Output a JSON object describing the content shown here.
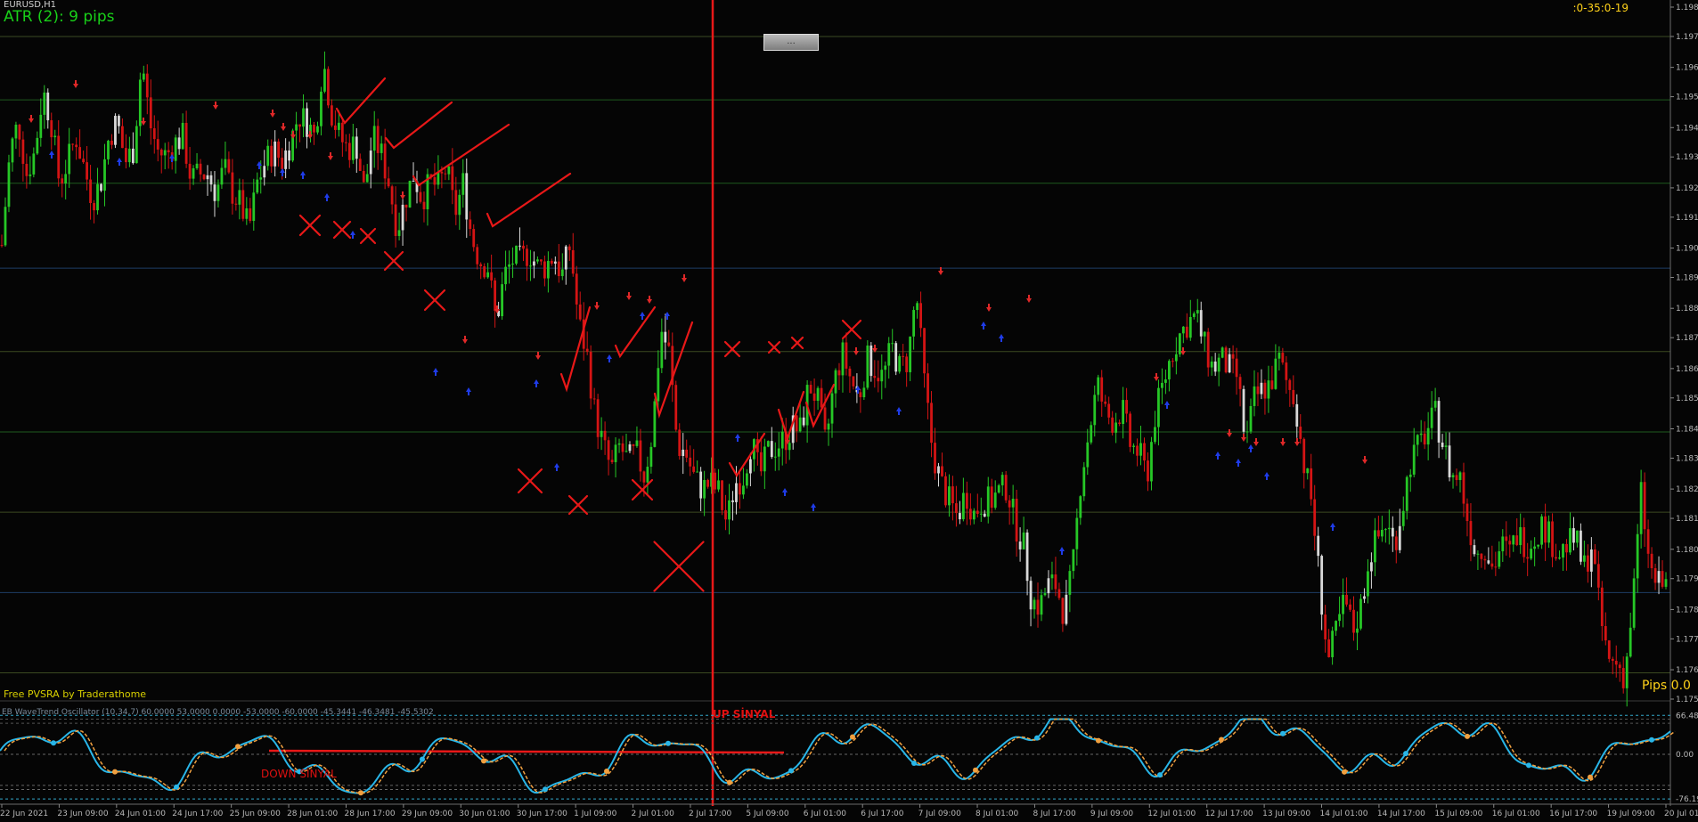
{
  "header": {
    "symbol": "EURUSD,H1",
    "atr_text": "ATR (2): 9 pips",
    "timer": ":0-35:0-19"
  },
  "top_button": {
    "label": "..."
  },
  "indicator": {
    "label": "Free  PVSRA  by  Traderathome",
    "header_text": "EB WaveTrend Oscillator (10,34,7) 60.0000 53.0000 0.0000 -53.0000 -60.0000 -45.3441 -46.3481 -45.5302",
    "scale": [
      "66.4856",
      "0.00",
      "-76.1966"
    ]
  },
  "annotations": {
    "up_signal": "UP SİNYAL",
    "down_signal": "DOWN SİNYAL",
    "pips": "Pips 0.0"
  },
  "chart_data": {
    "type": "candlestick",
    "symbol": "EURUSD",
    "timeframe": "H1",
    "price_axis": [
      "1.19820",
      "1.19725",
      "1.19625",
      "1.19530",
      "1.19430",
      "1.19335",
      "1.19235",
      "1.19140",
      "1.19040",
      "1.18945",
      "1.18845",
      "1.18750",
      "1.18650",
      "1.18555",
      "1.18455",
      "1.18360",
      "1.18260",
      "1.18165",
      "1.18065",
      "1.17970",
      "1.17870",
      "1.17775",
      "1.17675",
      "1.17580"
    ],
    "ylim": [
      1.1758,
      1.1982
    ],
    "time_axis": [
      "22 Jun 2021",
      "23 Jun 09:00",
      "24 Jun 01:00",
      "24 Jun 17:00",
      "25 Jun 09:00",
      "28 Jun 01:00",
      "28 Jun 17:00",
      "29 Jun 09:00",
      "30 Jun 01:00",
      "30 Jun 17:00",
      "1 Jul 09:00",
      "2 Jul 01:00",
      "2 Jul 17:00",
      "5 Jul 09:00",
      "6 Jul 01:00",
      "6 Jul 17:00",
      "7 Jul 09:00",
      "8 Jul 01:00",
      "8 Jul 17:00",
      "9 Jul 09:00",
      "12 Jul 01:00",
      "12 Jul 17:00",
      "13 Jul 09:00",
      "14 Jul 01:00",
      "14 Jul 17:00",
      "15 Jul 09:00",
      "16 Jul 01:00",
      "16 Jul 17:00",
      "19 Jul 09:00",
      "20 Jul 01:00"
    ],
    "price_path": [
      1.1905,
      1.1935,
      1.1945,
      1.1928,
      1.1935,
      1.1955,
      1.1945,
      1.1925,
      1.1932,
      1.194,
      1.193,
      1.192,
      1.1925,
      1.194,
      1.1945,
      1.1932,
      1.1936,
      1.1965,
      1.1944,
      1.1935,
      1.1934,
      1.1938,
      1.194,
      1.1926,
      1.1928,
      1.1928,
      1.1922,
      1.193,
      1.1922,
      1.1918,
      1.191,
      1.1925,
      1.1932,
      1.1936,
      1.1932,
      1.1938,
      1.1947,
      1.1945,
      1.194,
      1.1965,
      1.1948,
      1.194,
      1.1936,
      1.1938,
      1.1922,
      1.194,
      1.1935,
      1.1925,
      1.191,
      1.192,
      1.1928,
      1.192,
      1.1925,
      1.1924,
      1.193,
      1.1915,
      1.1925,
      1.1908,
      1.19,
      1.1898,
      1.188,
      1.1895,
      1.19,
      1.19,
      1.1903,
      1.1898,
      1.1898,
      1.1902,
      1.1895,
      1.1905,
      1.188,
      1.187,
      1.185,
      1.184,
      1.1832,
      1.184,
      1.1835,
      1.1838,
      1.183,
      1.1845,
      1.1878,
      1.187,
      1.184,
      1.1838,
      1.183,
      1.1826,
      1.1828,
      1.1825,
      1.1815,
      1.1828,
      1.183,
      1.1842,
      1.183,
      1.1838,
      1.184,
      1.1842,
      1.1846,
      1.1845,
      1.186,
      1.1855,
      1.184,
      1.186,
      1.187,
      1.1862,
      1.1855,
      1.1868,
      1.1865,
      1.1862,
      1.1872,
      1.1865,
      1.1868,
      1.189,
      1.186,
      1.1838,
      1.1828,
      1.1822,
      1.1817,
      1.1825,
      1.1818,
      1.1822,
      1.1822,
      1.1825,
      1.1827,
      1.1815,
      1.1808,
      1.179,
      1.1788,
      1.1795,
      1.1795,
      1.1785,
      1.18,
      1.183,
      1.1845,
      1.186,
      1.185,
      1.1848,
      1.1852,
      1.184,
      1.1838,
      1.183,
      1.185,
      1.186,
      1.187,
      1.1876,
      1.188,
      1.1882,
      1.1872,
      1.1865,
      1.1868,
      1.1865,
      1.1862,
      1.184,
      1.1855,
      1.1858,
      1.186,
      1.1868,
      1.186,
      1.1855,
      1.1835,
      1.1822,
      1.1795,
      1.177,
      1.178,
      1.179,
      1.178,
      1.1788,
      1.1805,
      1.181,
      1.1815,
      1.1808,
      1.182,
      1.1835,
      1.184,
      1.1845,
      1.185,
      1.184,
      1.183,
      1.183,
      1.1815,
      1.1805,
      1.1808,
      1.18,
      1.1808,
      1.1805,
      1.1812,
      1.1808,
      1.181,
      1.1815,
      1.181,
      1.1805,
      1.1808,
      1.181,
      1.18,
      1.1808,
      1.1785,
      1.177,
      1.177,
      1.1765,
      1.179,
      1.1825,
      1.18,
      1.1795,
      1.1795
    ]
  }
}
